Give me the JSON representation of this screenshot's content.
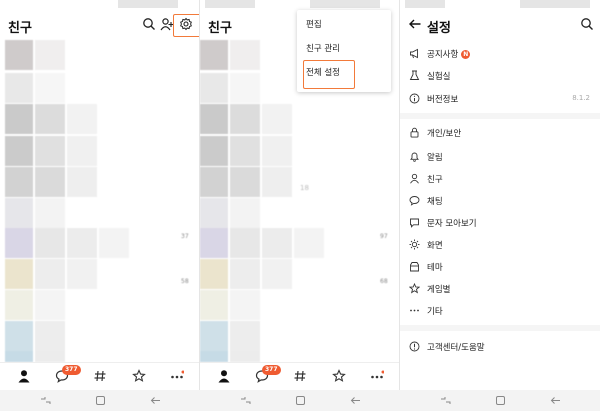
{
  "colors": {
    "accent": "#f27a3a",
    "badge": "#ef5b31"
  },
  "panel1": {
    "title": "친구",
    "counts": [
      "37",
      "58"
    ],
    "tab_badge": "377"
  },
  "panel2": {
    "title": "친구",
    "counts": [
      "97",
      "68"
    ],
    "side_number": "18",
    "tab_badge": "377",
    "menu": {
      "items": [
        "편집",
        "친구 관리",
        "전체 설정"
      ]
    }
  },
  "panel3": {
    "title": "설정",
    "items": [
      {
        "icon": "megaphone-icon",
        "label": "공지사항",
        "badge": "N"
      },
      {
        "icon": "flask-icon",
        "label": "실험실"
      },
      {
        "icon": "info-icon",
        "label": "버전정보",
        "value": "8.1.2"
      },
      {
        "icon": "lock-icon",
        "label": "개인/보안"
      },
      {
        "icon": "bell-icon",
        "label": "알림"
      },
      {
        "icon": "person-icon",
        "label": "친구"
      },
      {
        "icon": "chat-bubble-icon",
        "label": "채팅"
      },
      {
        "icon": "message-icon",
        "label": "문자 모아보기"
      },
      {
        "icon": "sun-icon",
        "label": "화면"
      },
      {
        "icon": "theme-icon",
        "label": "테마"
      },
      {
        "icon": "star-icon",
        "label": "게임별"
      },
      {
        "icon": "more-dots-icon",
        "label": "기타"
      },
      {
        "icon": "help-circle-icon",
        "label": "고객센터/도움말"
      }
    ]
  }
}
